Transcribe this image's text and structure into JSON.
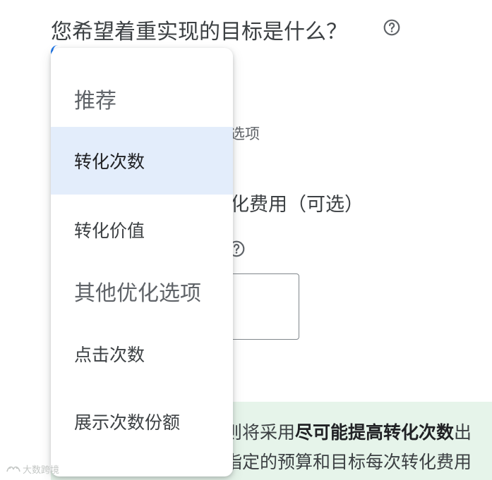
{
  "header": {
    "question": "您希望着重实现的目标是什么？",
    "help_icon": "help-circle-icon"
  },
  "background": {
    "optional_sub": "选项",
    "cost_label": "化费用（可选）",
    "info_line1_prefix": "则将采用",
    "info_line1_bold": "尽可能提高转化次数",
    "info_line1_suffix": "出",
    "info_line2": "指定的预算和目标每次转化费用"
  },
  "menu": {
    "groups": [
      {
        "header": "推荐",
        "items": [
          {
            "label": "转化次数",
            "selected": true
          },
          {
            "label": "转化价值",
            "selected": false
          }
        ]
      },
      {
        "header": "其他优化选项",
        "items": [
          {
            "label": "点击次数",
            "selected": false
          },
          {
            "label": "展示次数份额",
            "selected": false
          }
        ]
      }
    ]
  },
  "watermark": {
    "text": "大数跨境"
  },
  "colors": {
    "selected_bg": "#e3edfb",
    "info_bg": "#e6f4ea",
    "accent": "#1a73e8"
  }
}
